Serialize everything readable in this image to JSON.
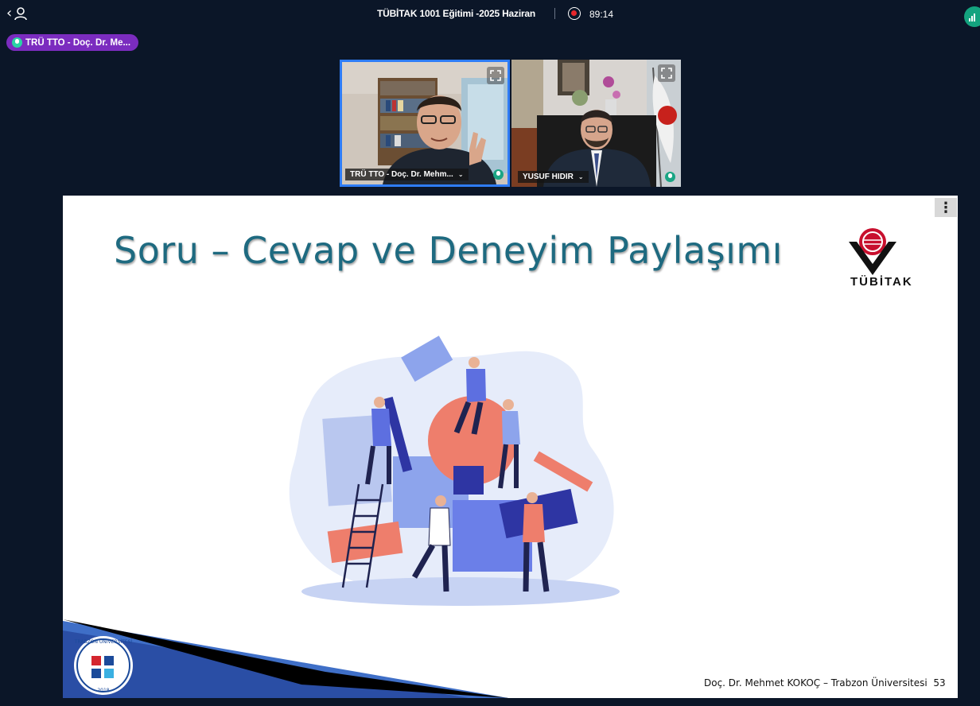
{
  "topbar": {
    "meeting_title": "TÜBİTAK 1001 Eğitimi -2025 Haziran",
    "timer": "89:14",
    "icons": [
      "chevron-left-icon",
      "user-icon",
      "record-icon",
      "signal-icon"
    ]
  },
  "active_speaker": {
    "label": "TRÜ TTO - Doç. Dr. Me..."
  },
  "participants": [
    {
      "name": "TRÜ TTO - Doç. Dr. Mehm...",
      "active": true
    },
    {
      "name": "YUSUF HIDIR",
      "active": false
    }
  ],
  "slide": {
    "title": "Soru – Cevap ve Deneyim Paylaşımı",
    "logo_text": "TÜBİTAK",
    "university_logo_text": "TRABZON ÜNİVERSİTESİ",
    "university_logo_year": "2018",
    "footer": "Doç. Dr. Mehmet KOKOÇ – Trabzon Üniversitesi",
    "page_number": "53"
  },
  "colors": {
    "background": "#0b1628",
    "accent_purple": "#7b2cbf",
    "accent_blue": "#2e7cf6",
    "mic_green": "#2ad3a4",
    "title_teal": "#1e6a80"
  }
}
